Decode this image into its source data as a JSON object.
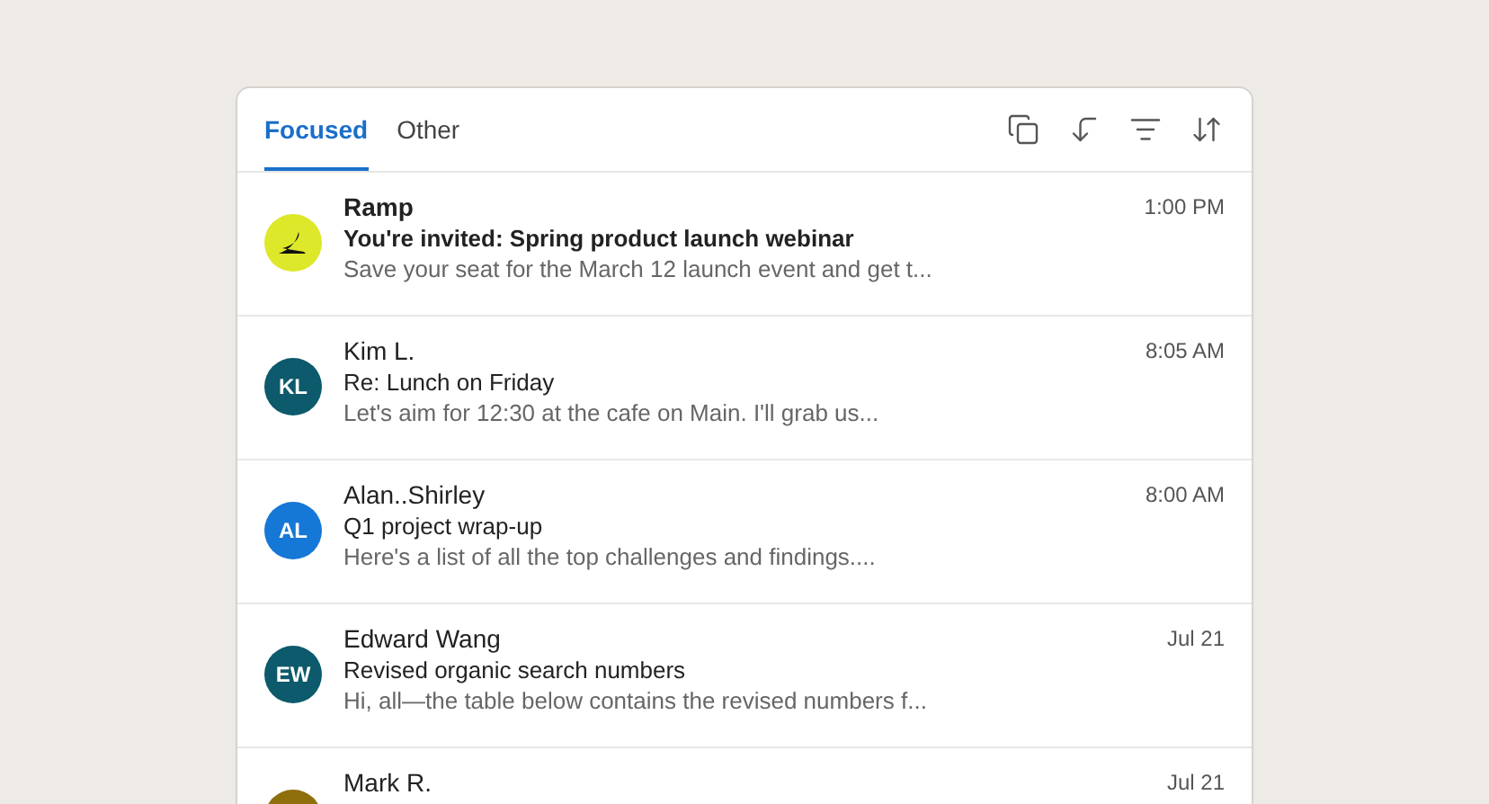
{
  "tabs": [
    {
      "label": "Focused",
      "selected": true
    },
    {
      "label": "Other",
      "selected": false
    }
  ],
  "messages": [
    {
      "sender": "Ramp",
      "subject": "You're invited: Spring product launch webinar",
      "preview": "Save your seat for the March 12 launch event and get t...",
      "time": "1:00 PM",
      "unread": true,
      "avatar": {
        "kind": "logo",
        "color": "#dde82a"
      }
    },
    {
      "sender": "Kim L.",
      "subject": "Re: Lunch on Friday",
      "preview": "Let's aim for 12:30 at the cafe on Main. I'll grab us...",
      "time": "8:05 AM",
      "unread": false,
      "avatar": {
        "kind": "initials",
        "initials": "KL",
        "color": "#0c5a6b"
      }
    },
    {
      "sender": "Alan..Shirley",
      "subject": "Q1 project wrap-up",
      "preview": "Here's a list of all the top challenges and findings....",
      "time": "8:00 AM",
      "unread": false,
      "avatar": {
        "kind": "initials",
        "initials": "AL",
        "color": "#1577d6"
      }
    },
    {
      "sender": "Edward Wang",
      "subject": "Revised organic search numbers",
      "preview": "Hi, all—the table below contains the revised numbers f...",
      "time": "Jul 21",
      "unread": false,
      "avatar": {
        "kind": "initials",
        "initials": "EW",
        "color": "#0c5a6b"
      }
    },
    {
      "sender": "Mark R.",
      "time": "Jul 21",
      "unread": false,
      "avatar": {
        "kind": "blank",
        "color": "#8f6f0c"
      }
    }
  ]
}
